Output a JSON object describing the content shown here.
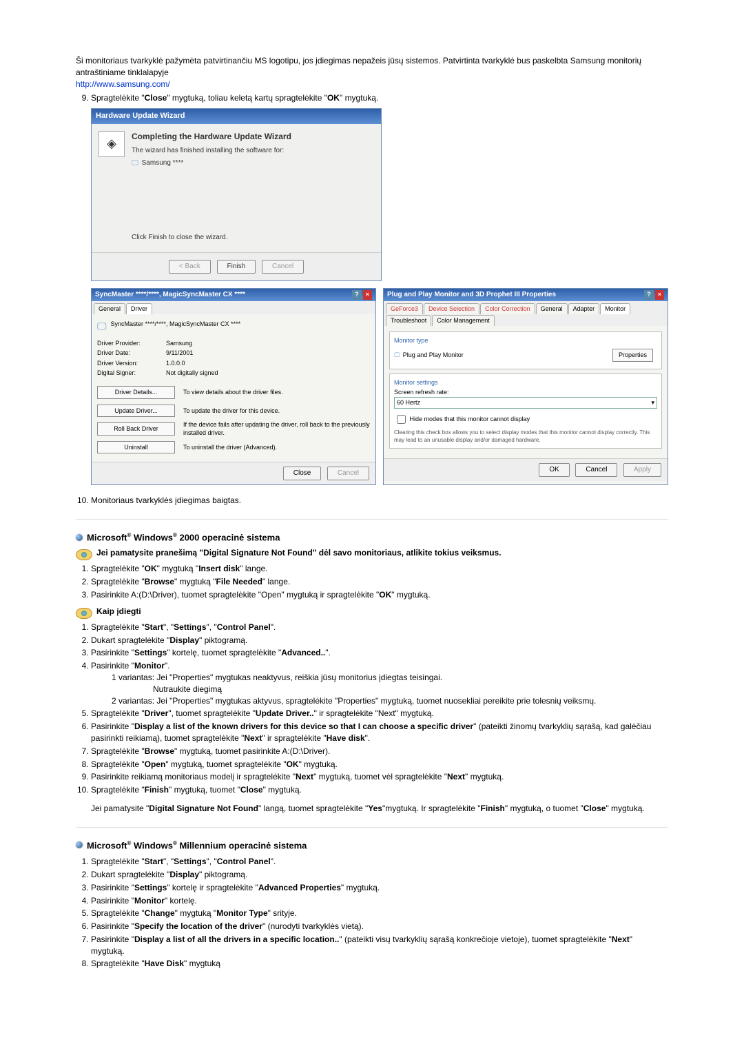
{
  "intro": {
    "p1": "Ši monitoriaus tvarkyklė pažymėta patvirtinančiu MS logotipu, jos įdiegimas nepažeis jūsų sistemos. Patvirtinta tvarkyklė bus paskelbta Samsung monitorių antraštiniame tinklalapyje",
    "link": "http://www.samsung.com/"
  },
  "step9": "Spragtelėkite \"Close\" mygtuką, toliau keletą kartų spragtelėkite \"OK\" mygtuką.",
  "wizard": {
    "title": "Hardware Update Wizard",
    "heading": "Completing the Hardware Update Wizard",
    "line1": "The wizard has finished installing the software for:",
    "device": "Samsung ****",
    "note": "Click Finish to close the wizard.",
    "btn_back": "< Back",
    "btn_finish": "Finish",
    "btn_cancel": "Cancel"
  },
  "driverPanel": {
    "title": "SyncMaster ****/****, MagicSyncMaster CX ****",
    "tab_general": "General",
    "tab_driver": "Driver",
    "device_name": "SyncMaster ****/****, MagicSyncMaster CX ****",
    "rows": [
      {
        "label": "Driver Provider:",
        "value": "Samsung"
      },
      {
        "label": "Driver Date:",
        "value": "9/11/2001"
      },
      {
        "label": "Driver Version:",
        "value": "1.0.0.0"
      },
      {
        "label": "Digital Signer:",
        "value": "Not digitally signed"
      }
    ],
    "btn_details": "Driver Details...",
    "btn_details_desc": "To view details about the driver files.",
    "btn_update": "Update Driver...",
    "btn_update_desc": "To update the driver for this device.",
    "btn_roll": "Roll Back Driver",
    "btn_roll_desc": "If the device fails after updating the driver, roll back to the previously installed driver.",
    "btn_uninstall": "Uninstall",
    "btn_uninstall_desc": "To uninstall the driver (Advanced).",
    "btn_close": "Close",
    "btn_cancel": "Cancel"
  },
  "monitorPanel": {
    "title": "Plug and Play Monitor and 3D Prophet III Properties",
    "tabs": [
      "GeForce3",
      "Device Selection",
      "Color Correction",
      "General",
      "Adapter",
      "Monitor",
      "Troubleshoot",
      "Color Management"
    ],
    "group1_title": "Monitor type",
    "group1_text": "Plug and Play Monitor",
    "btn_props": "Properties",
    "group2_title": "Monitor settings",
    "refresh_label": "Screen refresh rate:",
    "refresh_value": "60 Hertz",
    "check_label": "Hide modes that this monitor cannot display",
    "check_note": "Clearing this check box allows you to select display modes that this monitor cannot display correctly. This may lead to an unusable display and/or damaged hardware.",
    "btn_ok": "OK",
    "btn_cancel": "Cancel",
    "btn_apply": "Apply"
  },
  "step10": "Monitoriaus tvarkyklės įdiegimas baigtas.",
  "sec2000": {
    "title_pre": "Microsoft",
    "title_mid": " Windows",
    "title_post": " 2000 operacinė sistema",
    "warn": "Jei pamatysite pranešimą \"Digital Signature Not Found\" dėl savo monitoriaus, atlikite tokius veiksmus.",
    "steps1": [
      "Spragtelėkite \"OK\" mygtuką \"Insert disk\" lange.",
      "Spragtelėkite \"Browse\" mygtuką \"File Needed\" lange.",
      "Pasirinkite A:(D:\\Driver), tuomet spragtelėkite \"Open\" mygtuką ir spragtelėkite \"OK\" mygtuką."
    ],
    "install_head": "Kaip įdiegti",
    "steps2_1": "Spragtelėkite \"Start\", \"Settings\", \"Control Panel\".",
    "steps2_2": "Dukart spragtelėkite \"Display\" piktogramą.",
    "steps2_3": "Pasirinkite \"Settings\" kortelę, tuomet spragtelėkite \"Advanced..\".",
    "steps2_4": "Pasirinkite \"Monitor\".",
    "v1_a": "1 variantas:",
    "v1_b": "Jei \"Properties\" mygtukas neaktyvus, reiškia jūsų monitorius įdiegtas teisingai.",
    "v1_c": "Nutraukite diegimą",
    "v2_a": "2 variantas:",
    "v2_b": "Jei \"Properties\" mygtukas aktyvus, spragtelėkite \"Properties\" mygtuką, tuomet nuosekliai pereikite prie tolesnių veiksmų.",
    "steps2_5": "Spragtelėkite \"Driver\", tuomet spragtelėkite \"Update Driver..\" ir spragtelėkite \"Next\" mygtuką.",
    "steps2_6": "Pasirinkite \"Display a list of the known drivers for this device so that I can choose a specific driver\" (pateikti žinomų tvarkyklių sąrašą, kad galėčiau pasirinkti reikiamą), tuomet spragtelėkite \"Next\" ir spragtelėkite \"Have disk\".",
    "steps2_7": "Spragtelėkite \"Browse\" mygtuką, tuomet pasirinkite A:(D:\\Driver).",
    "steps2_8": "Spragtelėkite \"Open\" mygtuką, tuomet spragtelėkite \"OK\" mygtuką.",
    "steps2_9": "Pasirinkite reikiamą monitoriaus modelį ir spragtelėkite \"Next\" mygtuką, tuomet vėl spragtelėkite \"Next\" mygtuką.",
    "steps2_10": "Spragtelėkite \"Finish\" mygtuką, tuomet \"Close\" mygtuką.",
    "tail": "Jei pamatysite \"Digital Signature Not Found\" langą, tuomet spragtelėkite \"Yes\"mygtuką. Ir spragtelėkite \"Finish\" mygtuką, o tuomet \"Close\" mygtuką."
  },
  "secME": {
    "title_post": " Millennium operacinė sistema",
    "steps": [
      "Spragtelėkite \"Start\", \"Settings\", \"Control Panel\".",
      "Dukart spragtelėkite \"Display\" piktogramą.",
      "Pasirinkite \"Settings\" kortelę ir spragtelėkite \"Advanced Properties\" mygtuką.",
      "Pasirinkite \"Monitor\" kortelę.",
      "Spragtelėkite \"Change\" mygtuką \"Monitor Type\" srityje.",
      "Pasirinkite \"Specify the location of the driver\" (nurodyti tvarkyklės vietą).",
      "Pasirinkite \"Display a list of all the drivers in a specific location..\" (pateikti visų tvarkyklių sąrašą konkrečioje vietoje), tuomet spragtelėkite \"Next\" mygtuką.",
      "Spragtelėkite \"Have Disk\" mygtuką"
    ]
  }
}
